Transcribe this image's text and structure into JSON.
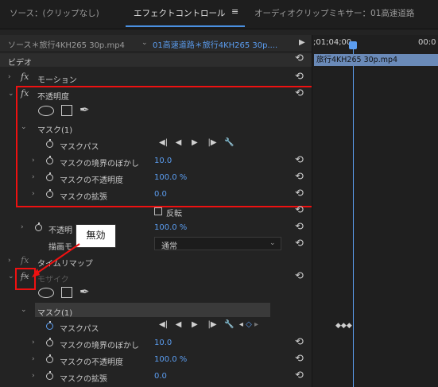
{
  "tabs": {
    "source": "ソース：(クリップなし)",
    "effect_controls": "エフェクトコントロール",
    "menu_glyph": "≡",
    "audio_mixer": "オーディオクリップミキサー：01高速道路"
  },
  "source_bar": {
    "source_clip": "ソース＊旅行4KH265 30p.mp4",
    "sequence_clip": "01高速道路＊旅行4KH265 30p....",
    "arrow": "▶"
  },
  "timeline": {
    "timecode_start": ";01;04;00",
    "timecode_end": "00:0",
    "clip_label": "旅行4KH265 30p.mp4"
  },
  "sections": {
    "video": "ビデオ"
  },
  "effects": {
    "motion": "モーション",
    "opacity": "不透明度",
    "mask1_label": "マスク(1)",
    "mask_path": "マスクパス",
    "feather_label": "マスクの境界のぼかし",
    "feather_value": "10.0",
    "mask_opacity_label": "マスクの不透明度",
    "mask_opacity_value": "100.0 %",
    "expansion_label": "マスクの拡張",
    "expansion_value": "0.0",
    "inverted_label": "反転",
    "opacity_param_label": "不透明",
    "opacity_param_value": "100.0 %",
    "blend_mode_label": "描画モ",
    "blend_mode_value": "通常",
    "time_remap": "タイムリマップ",
    "mosaic": "モザイク",
    "mosaic_mask_label": "マスク(1)",
    "mosaic_mask_path": "マスクパス",
    "mosaic_feather_label": "マスクの境界のぼかし",
    "mosaic_feather_value": "10.0",
    "mosaic_opacity_label": "マスクの不透明度",
    "mosaic_opacity_value": "100.0 %",
    "mosaic_expansion_label": "マスクの拡張",
    "mosaic_expansion_value": "0.0"
  },
  "annotation": {
    "callout_text": "無効"
  },
  "colors": {
    "accent_blue": "#5b9df0",
    "highlight_red": "#e11111",
    "clip_bar": "#6a8ab8"
  }
}
